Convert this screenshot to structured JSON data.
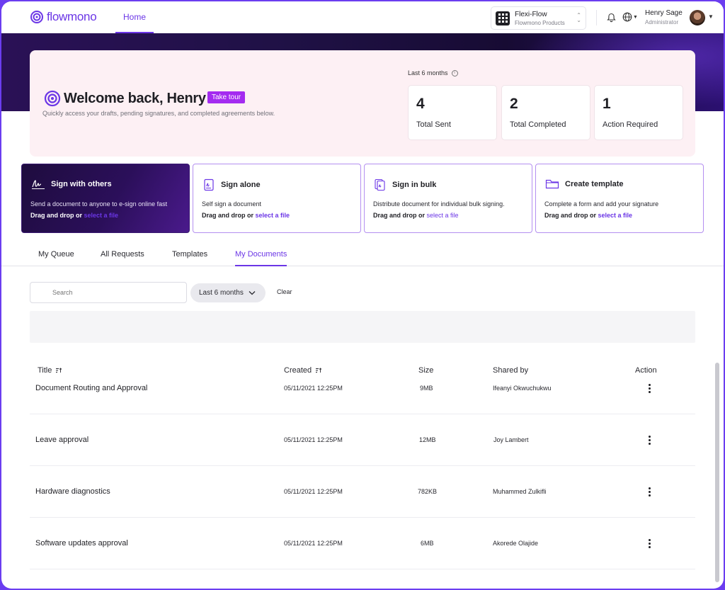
{
  "colors": {
    "accent": "#6b36e6",
    "tour": "#a42bf0",
    "frame": "#6b3df0",
    "hero_bg": "#fdf0f4"
  },
  "nav": {
    "brand": "flowmono",
    "home": "Home",
    "workspace": {
      "name": "Flexi-Flow",
      "sub": "Flowmono Products"
    },
    "user": {
      "name": "Henry Sage",
      "role": "Administrator"
    }
  },
  "welcome": {
    "title": "Welcome back, Henry",
    "tour": "Take tour",
    "subtitle": "Quickly access your drafts, pending signatures, and completed agreements below.",
    "period": "Last 6 months",
    "stats": [
      {
        "value": "4",
        "label": "Total Sent"
      },
      {
        "value": "2",
        "label": "Total Completed"
      },
      {
        "value": "1",
        "label": "Action Required"
      }
    ]
  },
  "actions": [
    {
      "title": "Sign with others",
      "desc": "Send a document to anyone to e-sign online fast",
      "drag": "Drag and drop or ",
      "link": "select a file",
      "icon": "signature-icon"
    },
    {
      "title": "Sign alone",
      "desc": "Self sign a document",
      "drag": "Drag and drop or ",
      "link": "select a file",
      "icon": "document-sign-icon"
    },
    {
      "title": "Sign in bulk",
      "desc": "Distribute document for individual bulk signing.",
      "drag": "Drag and drop or ",
      "link": "select a file",
      "icon": "documents-stack-icon"
    },
    {
      "title": "Create template",
      "desc": "Complete a form and add your signature",
      "drag": "Drag and drop or ",
      "link": "select a file",
      "icon": "folder-icon"
    }
  ],
  "tabs": [
    "My Queue",
    "All Requests",
    "Templates",
    "My Documents"
  ],
  "filters": {
    "search_placeholder": "Search",
    "period": "Last 6 months",
    "clear": "Clear"
  },
  "table": {
    "headers": {
      "title": "Title",
      "created": "Created",
      "size": "Size",
      "shared_by": "Shared by",
      "action": "Action"
    },
    "rows": [
      {
        "title": "Document Routing and Approval",
        "created": "05/11/2021 12:25PM",
        "size": "9MB",
        "shared_by": "Ifeanyi Okwuchukwu"
      },
      {
        "title": "Leave approval",
        "created": "05/11/2021 12:25PM",
        "size": "12MB",
        "shared_by": "Joy Lambert"
      },
      {
        "title": "Hardware diagnostics",
        "created": "05/11/2021 12:25PM",
        "size": "782KB",
        "shared_by": "Muhammed Zulkifli"
      },
      {
        "title": "Software updates approval",
        "created": "05/11/2021 12:25PM",
        "size": "6MB",
        "shared_by": "Akorede Olajide"
      }
    ]
  }
}
